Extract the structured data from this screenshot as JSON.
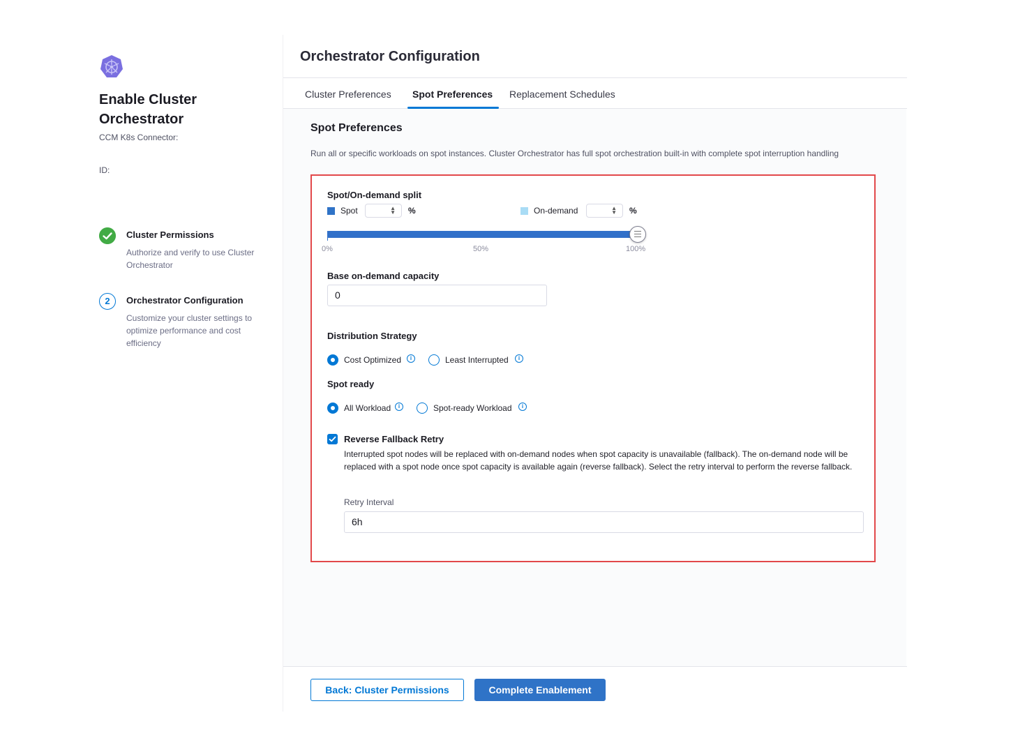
{
  "sidebar": {
    "title": "Enable Cluster Orchestrator",
    "connector_label": "CCM K8s Connector:",
    "id_label": "ID:",
    "steps": [
      {
        "title": "Cluster Permissions",
        "description": "Authorize and verify to use Cluster Orchestrator",
        "status": "complete"
      },
      {
        "number": "2",
        "title": "Orchestrator Configuration",
        "description": "Customize your cluster settings to optimize performance and cost efficiency",
        "status": "current"
      }
    ]
  },
  "main": {
    "title": "Orchestrator Configuration",
    "tabs": [
      {
        "label": "Cluster Preferences",
        "active": false
      },
      {
        "label": "Spot Preferences",
        "active": true
      },
      {
        "label": "Replacement Schedules",
        "active": false
      }
    ],
    "section_title": "Spot Preferences",
    "section_description": "Run all or specific workloads on spot instances. Cluster Orchestrator has full spot orchestration built-in with complete spot interruption handling",
    "split": {
      "label": "Spot/On-demand split",
      "spot_label": "Spot",
      "ondemand_label": "On-demand",
      "percent_sign": "%",
      "spot_color": "#2f73c7",
      "ondemand_color": "#a9dcf5",
      "slider_spot_percent": 100,
      "tick_labels": [
        "0%",
        "50%",
        "100%"
      ]
    },
    "base_capacity": {
      "label": "Base on-demand capacity",
      "value": "0"
    },
    "distribution": {
      "label": "Distribution Strategy",
      "options": [
        {
          "label": "Cost Optimized",
          "selected": true
        },
        {
          "label": "Least Interrupted",
          "selected": false
        }
      ]
    },
    "spot_ready": {
      "label": "Spot ready",
      "options": [
        {
          "label": "All Workload",
          "selected": true
        },
        {
          "label": "Spot-ready Workload",
          "selected": false
        }
      ]
    },
    "fallback": {
      "label": "Reverse Fallback Retry",
      "checked": true,
      "description": "Interrupted spot nodes will be replaced with on-demand nodes when spot capacity is unavailable (fallback). The on-demand node will be replaced with a spot node once spot capacity is available again (reverse fallback). Select the retry interval to perform the reverse fallback.",
      "retry_label": "Retry Interval",
      "retry_value": "6h"
    }
  },
  "footer": {
    "back_label": "Back: Cluster Permissions",
    "complete_label": "Complete Enablement"
  },
  "colors": {
    "accent": "#0278d5",
    "success": "#42ab45",
    "highlight_border": "#e2484a"
  }
}
